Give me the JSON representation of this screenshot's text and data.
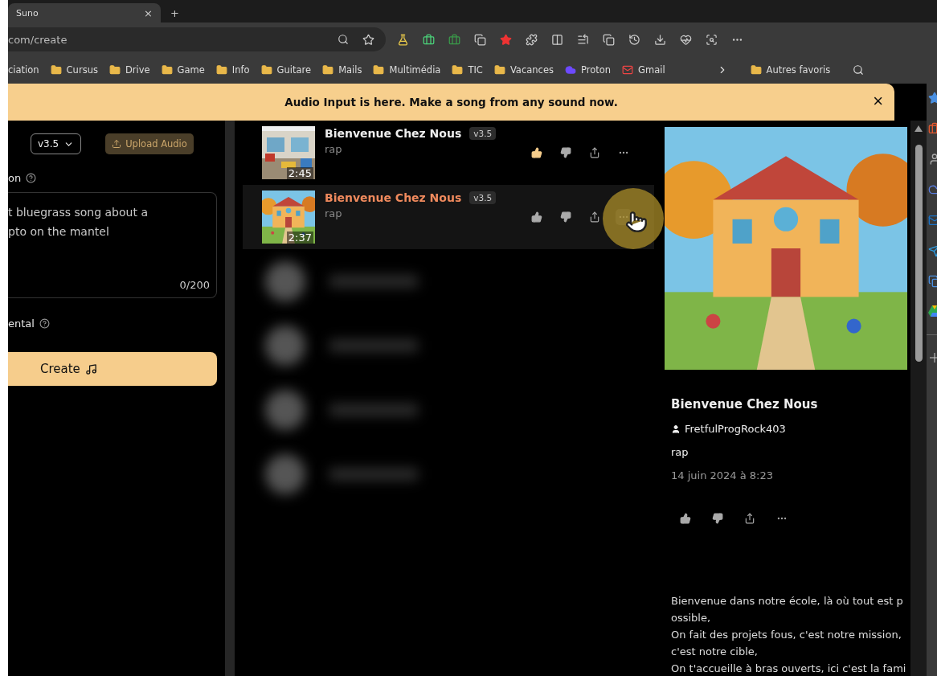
{
  "browser": {
    "tab": {
      "title": "Suno",
      "close": "×"
    },
    "new_tab": "+",
    "address": "com/create",
    "bookmarks": [
      {
        "label": "ciation",
        "kind": "text"
      },
      {
        "label": "Cursus",
        "kind": "folder"
      },
      {
        "label": "Drive",
        "kind": "folder"
      },
      {
        "label": "Game",
        "kind": "folder"
      },
      {
        "label": "Info",
        "kind": "folder"
      },
      {
        "label": "Guitare",
        "kind": "folder"
      },
      {
        "label": "Mails",
        "kind": "folder"
      },
      {
        "label": "Multimédia",
        "kind": "folder"
      },
      {
        "label": "TIC",
        "kind": "folder"
      },
      {
        "label": "Vacances",
        "kind": "folder"
      },
      {
        "label": "Proton",
        "kind": "proton"
      },
      {
        "label": "Gmail",
        "kind": "gmail"
      }
    ],
    "other_bookmarks": "Autres favoris"
  },
  "banner": {
    "text": "Audio Input is here. Make a song from any sound now.",
    "close": "×"
  },
  "create_panel": {
    "version": "v3.5",
    "upload": "Upload Audio",
    "description_label": "on",
    "prompt_placeholder": "t bluegrass song about a\npto on the mantel",
    "counter": "0/200",
    "instrumental_label": "ental",
    "create": "Create"
  },
  "songs": [
    {
      "title": "Bienvenue Chez Nous",
      "version": "v3.5",
      "genre": "rap",
      "duration": "2:45",
      "selected": false,
      "liked": true,
      "hovered": false
    },
    {
      "title": "Bienvenue Chez Nous",
      "version": "v3.5",
      "genre": "rap",
      "duration": "2:37",
      "selected": true,
      "liked": false,
      "hovered": true
    }
  ],
  "detail": {
    "title": "Bienvenue Chez Nous",
    "author": "FretfulProgRock403",
    "genre": "rap",
    "date": "14 juin 2024 à 8:23",
    "lyrics": [
      "Bienvenue dans notre école, là où tout est p",
      "ossible,",
      "On fait des projets fous, c'est notre mission,",
      "c'est notre cible,",
      "On t'accueille à bras ouverts, ici c'est la fami"
    ]
  }
}
